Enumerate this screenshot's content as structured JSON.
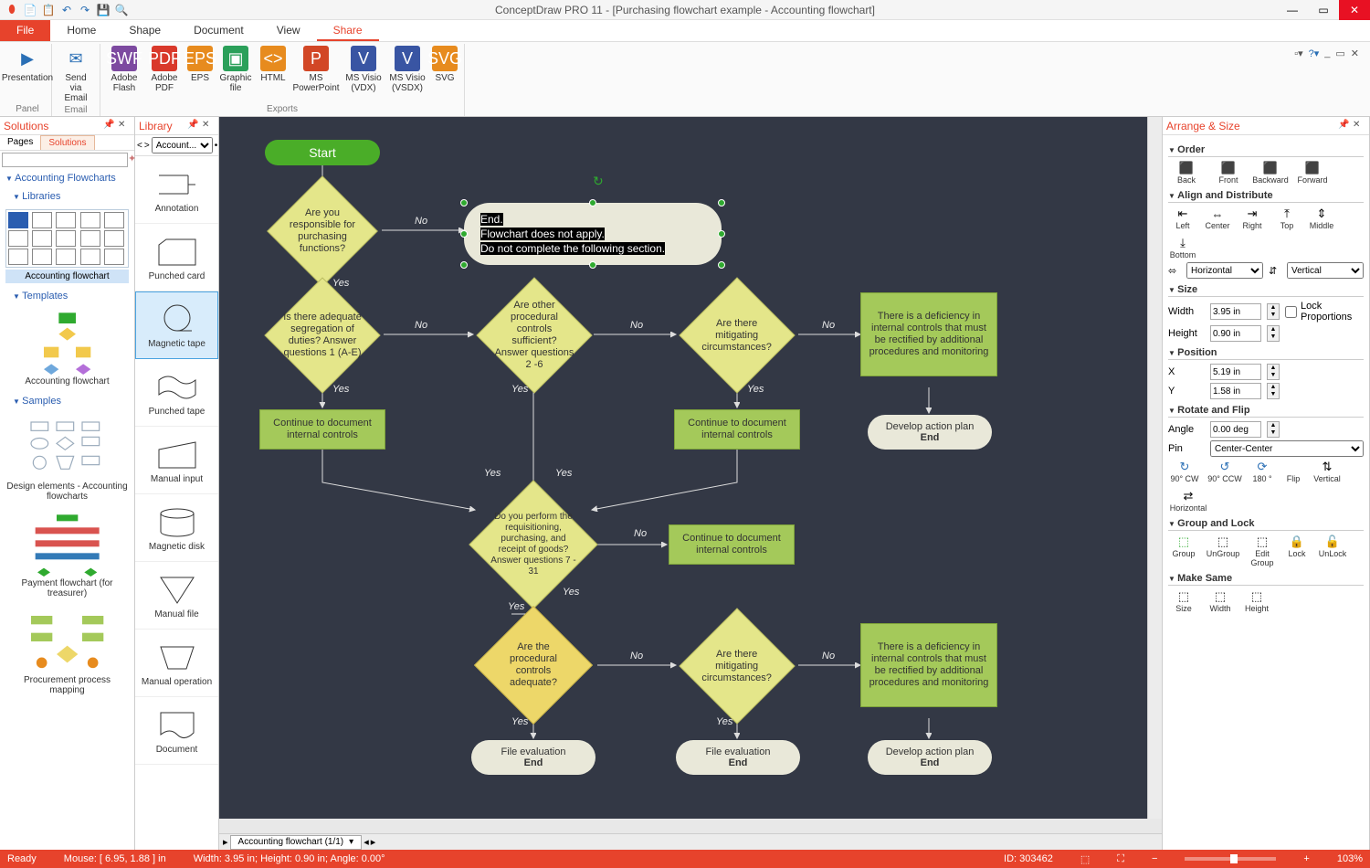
{
  "title": "ConceptDraw PRO 11 - [Purchasing flowchart example - Accounting flowchart]",
  "menu": {
    "file": "File",
    "home": "Home",
    "shape": "Shape",
    "document": "Document",
    "view": "View",
    "share": "Share"
  },
  "ribbon": {
    "presentation": "Presentation",
    "send": "Send via Email",
    "flash": "Adobe Flash",
    "pdf": "Adobe PDF",
    "eps": "EPS",
    "gfx": "Graphic file",
    "html": "HTML",
    "ppt": "MS PowerPoint",
    "vdx": "MS Visio (VDX)",
    "vsdx": "MS Visio (VSDX)",
    "svg": "SVG",
    "g_panel": "Panel",
    "g_email": "Email",
    "g_exports": "Exports"
  },
  "solutions": {
    "title": "Solutions",
    "tab_pages": "Pages",
    "tab_solutions": "Solutions",
    "accounting_flowcharts": "Accounting Flowcharts",
    "libraries": "Libraries",
    "accounting_flowchart": "Accounting flowchart",
    "templates": "Templates",
    "samples": "Samples",
    "tmpl_accounting": "Accounting flowchart",
    "sample_design": "Design elements - Accounting flowcharts",
    "sample_payment": "Payment flowchart (for treasurer)",
    "sample_procurement": "Procurement process mapping"
  },
  "library": {
    "title": "Library",
    "dropdown": "Account...",
    "annotation": "Annotation",
    "punched_card": "Punched card",
    "magnetic_tape": "Magnetic tape",
    "punched_tape": "Punched tape",
    "manual_input": "Manual input",
    "magnetic_disk": "Magnetic disk",
    "manual_file": "Manual file",
    "manual_operation": "Manual operation",
    "document": "Document"
  },
  "canvas": {
    "start": "Start",
    "d1": "Are you responsible for purchasing functions?",
    "sel_l1": "End.",
    "sel_l2": "Flowchart does not apply.",
    "sel_l3": "Do not complete the following section.",
    "d2": "Is there adequate segregation of duties? Answer questions 1 (A-E)",
    "d3": "Are other procedural controls sufficient? Answer questions 2 -6",
    "d4": "Are there mitigating circumstances?",
    "p_def": "There is a deficiency in internal controls that must be rectified by additional procedures and monitoring",
    "p_cont": "Continue to document internal controls",
    "end_dev_l1": "Develop action plan",
    "end_dev_l2": "End",
    "d5": "Do you perform the requisitioning, purchasing, and receipt of goods? Answer questions 7 - 31",
    "d6": "Are the procedural controls adequate?",
    "end_file_l1": "File evaluation",
    "end_file_l2": "End",
    "yes": "Yes",
    "no": "No"
  },
  "doc_tab": "Accounting flowchart (1/1)",
  "status": {
    "ready": "Ready",
    "mouse": "Mouse: [ 6.95, 1.88 ] in",
    "dims": "Width: 3.95 in;  Height: 0.90 in;  Angle: 0.00°",
    "id": "ID: 303462",
    "zoom": "103%"
  },
  "arrange": {
    "title": "Arrange & Size",
    "order": "Order",
    "back": "Back",
    "front": "Front",
    "backward": "Backward",
    "forward": "Forward",
    "align": "Align and Distribute",
    "left": "Left",
    "center": "Center",
    "right": "Right",
    "top": "Top",
    "middle": "Middle",
    "bottom": "Bottom",
    "horizontal": "Horizontal",
    "vertical": "Vertical",
    "size": "Size",
    "width_l": "Width",
    "width_v": "3.95 in",
    "height_l": "Height",
    "height_v": "0.90 in",
    "lockprop": "Lock Proportions",
    "position": "Position",
    "x_l": "X",
    "x_v": "5.19 in",
    "y_l": "Y",
    "y_v": "1.58 in",
    "rotate": "Rotate and Flip",
    "angle_l": "Angle",
    "angle_v": "0.00 deg",
    "pin_l": "Pin",
    "pin_v": "Center-Center",
    "cw": "90° CW",
    "ccw": "90° CCW",
    "r180": "180 °",
    "flip": "Flip",
    "flipv": "Vertical",
    "fliph": "Horizontal",
    "gl": "Group and Lock",
    "group": "Group",
    "ungroup": "UnGroup",
    "editgroup": "Edit Group",
    "lock": "Lock",
    "unlock": "UnLock",
    "ms": "Make Same",
    "ms_size": "Size",
    "ms_width": "Width",
    "ms_height": "Height"
  }
}
